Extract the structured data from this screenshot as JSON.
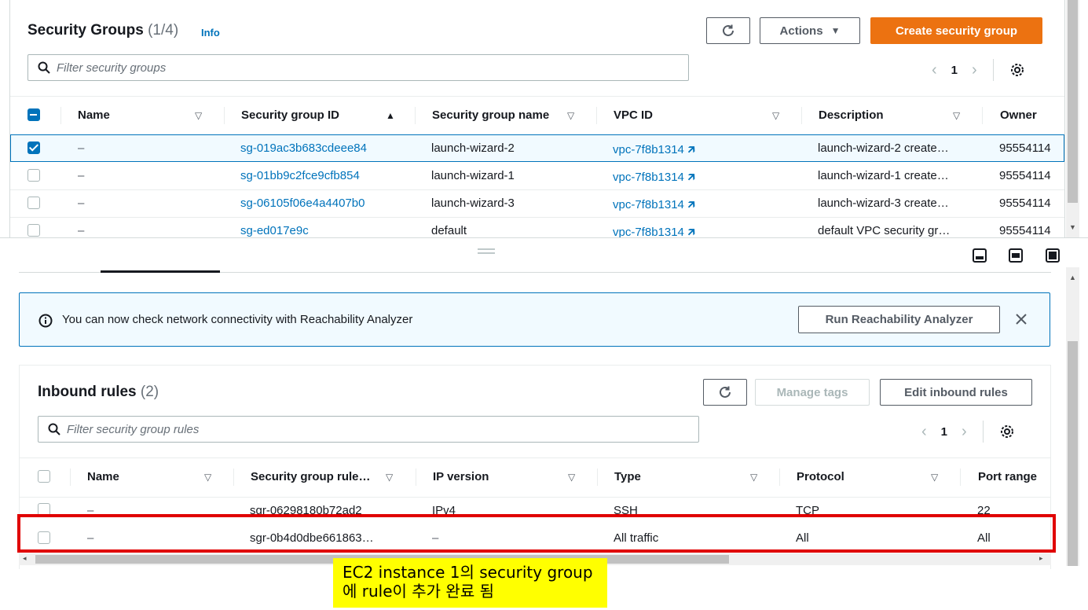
{
  "security_groups": {
    "title": "Security Groups",
    "count": "(1/4)",
    "info": "Info",
    "actions_label": "Actions",
    "create_label": "Create security group",
    "filter_placeholder": "Filter security groups",
    "page": "1",
    "columns": [
      "Name",
      "Security group ID",
      "Security group name",
      "VPC ID",
      "Description",
      "Owner"
    ],
    "rows": [
      {
        "selected": true,
        "name": "–",
        "id": "sg-019ac3b683cdeee84",
        "group_name": "launch-wizard-2",
        "vpc": "vpc-7f8b1314",
        "description": "launch-wizard-2 create…",
        "owner": "95554114"
      },
      {
        "selected": false,
        "name": "–",
        "id": "sg-01bb9c2fce9cfb854",
        "group_name": "launch-wizard-1",
        "vpc": "vpc-7f8b1314",
        "description": "launch-wizard-1 create…",
        "owner": "95554114"
      },
      {
        "selected": false,
        "name": "–",
        "id": "sg-06105f06e4a4407b0",
        "group_name": "launch-wizard-3",
        "vpc": "vpc-7f8b1314",
        "description": "launch-wizard-3 create…",
        "owner": "95554114"
      },
      {
        "selected": false,
        "name": "–",
        "id": "sg-ed017e9c",
        "group_name": "default",
        "vpc": "vpc-7f8b1314",
        "description": "default VPC security gr…",
        "owner": "95554114"
      }
    ]
  },
  "banner": {
    "text": "You can now check network connectivity with Reachability Analyzer",
    "button": "Run Reachability Analyzer"
  },
  "inbound": {
    "title": "Inbound rules",
    "count": "(2)",
    "manage_tags": "Manage tags",
    "edit_label": "Edit inbound rules",
    "filter_placeholder": "Filter security group rules",
    "page": "1",
    "columns": [
      "Name",
      "Security group rule…",
      "IP version",
      "Type",
      "Protocol",
      "Port range"
    ],
    "rows": [
      {
        "name": "–",
        "rule_id": "sgr-06298180b72ad2",
        "ip_version": "IPv4",
        "type": "SSH",
        "protocol": "TCP",
        "port": "22"
      },
      {
        "name": "–",
        "rule_id": "sgr-0b4d0dbe661863…",
        "ip_version": "–",
        "type": "All traffic",
        "protocol": "All",
        "port": "All"
      }
    ]
  },
  "annotation": {
    "line1": "EC2 instance 1의 security group",
    "line2": "에 rule이 추가 완료 됨"
  },
  "colors": {
    "accent": "#0073bb",
    "primary": "#ec7211",
    "highlight": "#e00000",
    "callout": "#ffff00"
  }
}
